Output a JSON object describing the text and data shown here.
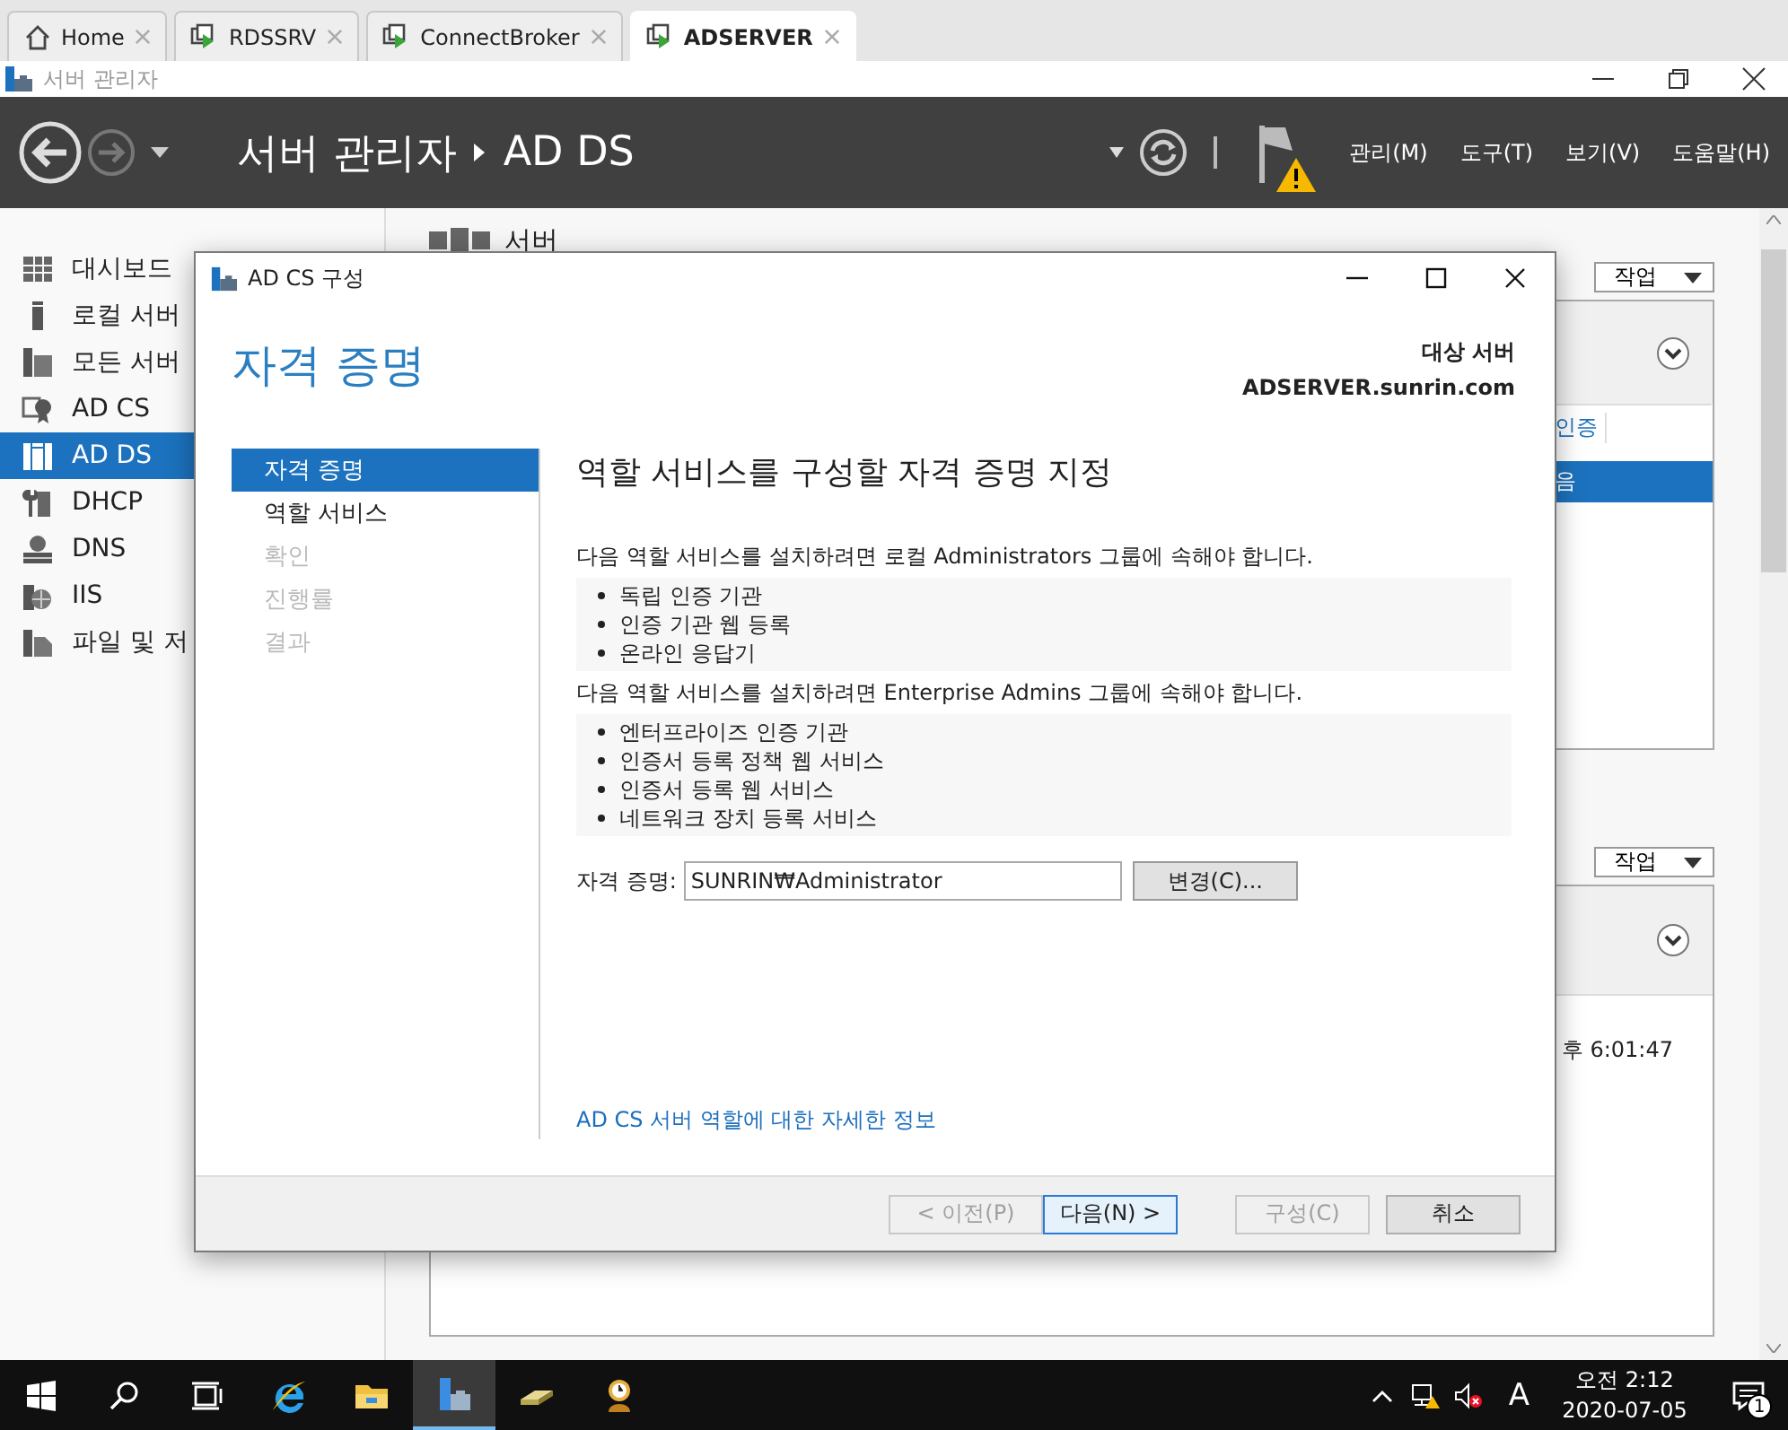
{
  "browser_tabs": [
    {
      "label": "Home",
      "selected": false,
      "kind": "home"
    },
    {
      "label": "RDSSRV",
      "selected": false,
      "kind": "remote"
    },
    {
      "label": "ConnectBroker",
      "selected": false,
      "kind": "remote"
    },
    {
      "label": "ADSERVER",
      "selected": true,
      "kind": "remote"
    }
  ],
  "app_window": {
    "title": "서버 관리자"
  },
  "header": {
    "breadcrumb_root": "서버 관리자",
    "breadcrumb_current": "AD DS",
    "menu": [
      "관리(M)",
      "도구(T)",
      "보기(V)",
      "도움말(H)"
    ]
  },
  "sidebar": {
    "items": [
      {
        "label": "대시보드",
        "selected": false
      },
      {
        "label": "로컬 서버",
        "selected": false
      },
      {
        "label": "모든 서버",
        "selected": false
      },
      {
        "label": "AD CS",
        "selected": false
      },
      {
        "label": "AD DS",
        "selected": true
      },
      {
        "label": "DHCP",
        "selected": false
      },
      {
        "label": "DNS",
        "selected": false
      },
      {
        "label": "IIS",
        "selected": false
      },
      {
        "label": "파일 및 저",
        "selected": false
      }
    ]
  },
  "content": {
    "heading": "서버",
    "panels": [
      {
        "action": "작업",
        "column_header": "인증",
        "row_text": "음"
      },
      {
        "action": "작업",
        "row_text": "후 6:01:47"
      }
    ]
  },
  "dialog": {
    "title": "AD CS 구성",
    "page_title": "자격 증명",
    "target_label": "대상 서버",
    "target_server": "ADSERVER.sunrin.com",
    "steps": [
      {
        "label": "자격 증명",
        "selected": true,
        "disabled": false
      },
      {
        "label": "역할 서비스",
        "selected": false,
        "disabled": false
      },
      {
        "label": "확인",
        "selected": false,
        "disabled": true
      },
      {
        "label": "진행률",
        "selected": false,
        "disabled": true
      },
      {
        "label": "결과",
        "selected": false,
        "disabled": true
      }
    ],
    "heading": "역할 서비스를 구성할 자격 증명 지정",
    "groups": [
      {
        "text": "다음 역할 서비스를 설치하려면 로컬 Administrators 그룹에 속해야 합니다.",
        "items": [
          "독립 인증 기관",
          "인증 기관 웹 등록",
          "온라인 응답기"
        ]
      },
      {
        "text": "다음 역할 서비스를 설치하려면 Enterprise Admins 그룹에 속해야 합니다.",
        "items": [
          "엔터프라이즈 인증 기관",
          "인증서 등록 정책 웹 서비스",
          "인증서 등록 웹 서비스",
          "네트워크 장치 등록 서비스"
        ]
      }
    ],
    "credential_label": "자격 증명:",
    "credential_value": "SUNRIN₩Administrator",
    "change_button": "변경(C)...",
    "help_link": "AD CS 서버 역할에 대한 자세한 정보",
    "buttons": [
      {
        "label": "< 이전(P)",
        "disabled": true,
        "default": false
      },
      {
        "label": "다음(N) >",
        "disabled": false,
        "default": true
      },
      {
        "label": "구성(C)",
        "disabled": true,
        "default": false
      },
      {
        "label": "취소",
        "disabled": false,
        "default": false
      }
    ]
  },
  "taskbar": {
    "apps": [
      {
        "kind": "ie",
        "selected": false
      },
      {
        "kind": "explorer",
        "selected": false
      },
      {
        "kind": "server-manager",
        "selected": true
      },
      {
        "kind": "drive",
        "selected": false
      },
      {
        "kind": "clock-tool",
        "selected": false
      }
    ],
    "input_indicator": "A",
    "time": "오전 2:12",
    "date": "2020-07-05",
    "notification_count": "1"
  }
}
